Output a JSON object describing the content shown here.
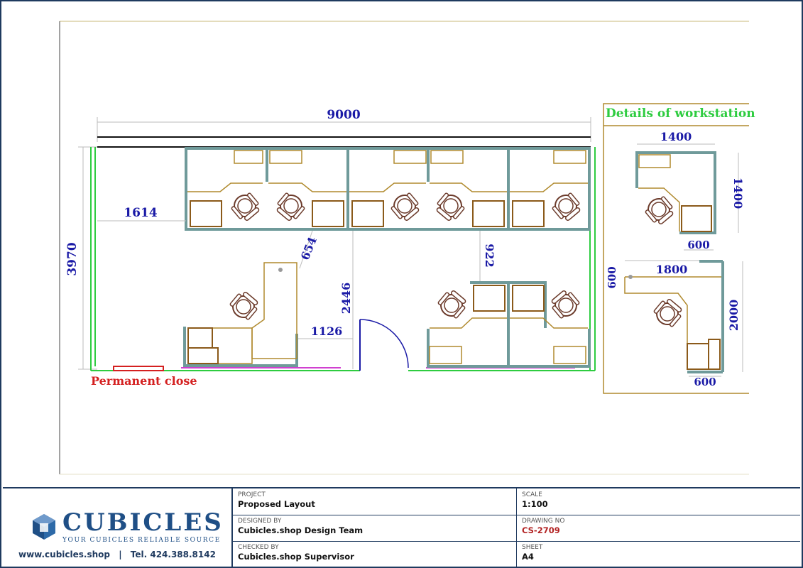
{
  "plan": {
    "overall_width": "9000",
    "overall_height": "3970",
    "dim_left_gap": "1614",
    "dim_diagonal": "654",
    "dim_aisle_right": "922",
    "dim_aisle_center": "2446",
    "dim_desk_gap": "1126",
    "permanent_close": "Permanent close",
    "colors": {
      "dimension": "#1a1aa6",
      "wall": "#2ecc40",
      "panel": "#6f9a9a",
      "desk": "#b08a2e",
      "chair": "#6b3a2a",
      "close": "#d42020",
      "glass": "#d040d0"
    }
  },
  "details": {
    "title": "Details of workstation",
    "dim_l_width": "1400",
    "dim_l_height": "1400",
    "dim_l_pedestal": "600",
    "dim_corner_width": "1800",
    "dim_corner_left": "600",
    "dim_corner_height": "2000",
    "dim_corner_pedestal": "600"
  },
  "title_block": {
    "logo_word": "CUBICLES",
    "logo_tagline": "YOUR CUBICLES RELIABLE SOURCE",
    "website": "www.cubicles.shop",
    "separator": "|",
    "phone": "Tel. 424.388.8142",
    "project_label": "PROJECT",
    "project_value": "Proposed Layout",
    "designed_label": "DESIGNED BY",
    "designed_value": "Cubicles.shop Design Team",
    "checked_label": "CHECKED BY",
    "checked_value": "Cubicles.shop Supervisor",
    "scale_label": "SCALE",
    "scale_value": "1:100",
    "drawing_label": "DRAWING NO",
    "drawing_value": "CS-2709",
    "sheet_label": "SHEET",
    "sheet_value": "A4"
  }
}
